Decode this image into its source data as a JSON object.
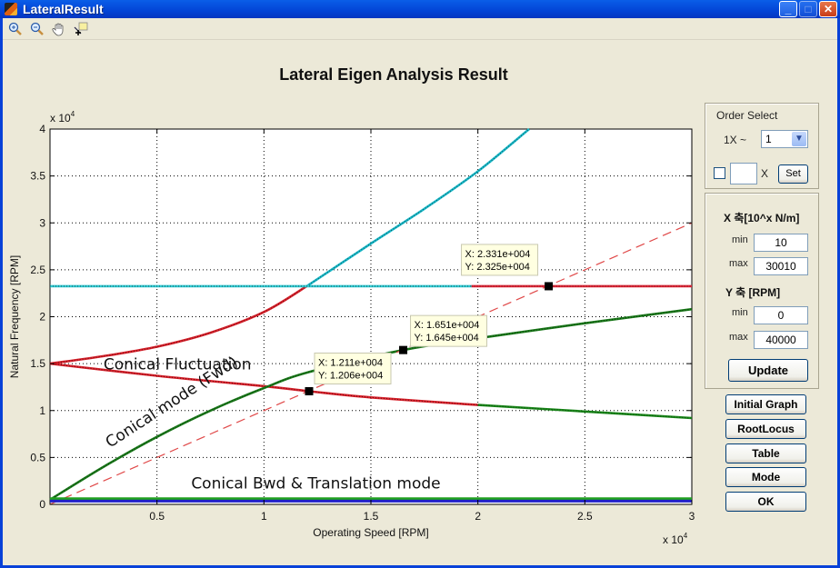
{
  "window": {
    "title": "LateralResult",
    "buttons": [
      "minimize",
      "maximize",
      "close"
    ]
  },
  "toolbar": {
    "tools": [
      "zoom-in-icon",
      "zoom-out-icon",
      "pan-hand-icon",
      "data-cursor-icon"
    ]
  },
  "plot_title": "Lateral Eigen Analysis Result",
  "order_select": {
    "title": "Order Select",
    "prefix": "1X ~",
    "selected": "1",
    "custom_checked": false,
    "custom_value": "",
    "x_suffix": "X",
    "set_label": "Set"
  },
  "axis_panel": {
    "x_title": "X 축[10^x N/m]",
    "x_min_label": "min",
    "x_min": "10",
    "x_max_label": "max",
    "x_max": "30010",
    "y_title": "Y 축 [RPM]",
    "y_min_label": "min",
    "y_min": "0",
    "y_max_label": "max",
    "y_max": "40000",
    "update_label": "Update"
  },
  "actions": [
    "Initial Graph",
    "RootLocus",
    "Table",
    "Mode",
    "OK"
  ],
  "chart_data": {
    "type": "line",
    "title": "Lateral Eigen Analysis Result",
    "xlabel": "Operating Speed [RPM]",
    "ylabel": "Natural Frequency [RPM]",
    "x_multiplier": "x 10^4",
    "y_multiplier": "x 10^4",
    "xlim": [
      0,
      3
    ],
    "ylim": [
      0,
      4
    ],
    "xticks": [
      0.5,
      1,
      1.5,
      2,
      2.5,
      3
    ],
    "xtick_labels": [
      "0.5",
      "1",
      "1.5",
      "2",
      "2.5",
      "3"
    ],
    "yticks": [
      0,
      0.5,
      1,
      1.5,
      2,
      2.5,
      3,
      3.5,
      4
    ],
    "ytick_labels": [
      "0",
      "0.5",
      "1",
      "1.5",
      "2",
      "2.5",
      "3",
      "3.5",
      "4"
    ],
    "grid": true,
    "series": [
      {
        "name": "fluctuation-upper-red",
        "color": "#d8202a",
        "style": "dotted-thick",
        "x": [
          0,
          0.25,
          0.5,
          0.75,
          1.0,
          1.2
        ],
        "y": [
          1.5,
          1.58,
          1.68,
          1.83,
          2.05,
          2.325
        ]
      },
      {
        "name": "fluctuation-upper-cyan",
        "color": "#18b8c8",
        "style": "dotted-thick",
        "x": [
          1.2,
          1.5,
          1.75,
          2.0,
          2.24
        ],
        "y": [
          2.325,
          2.78,
          3.15,
          3.55,
          4.0
        ]
      },
      {
        "name": "horizontal-cyan",
        "color": "#30c8d0",
        "style": "dotted-thick",
        "x": [
          0,
          1.97
        ],
        "y": [
          2.325,
          2.325
        ]
      },
      {
        "name": "horizontal-red",
        "color": "#e02838",
        "style": "dotted-thick",
        "x": [
          1.97,
          3.0
        ],
        "y": [
          2.325,
          2.325
        ]
      },
      {
        "name": "fluctuation-lower-red",
        "color": "#d8202a",
        "style": "dotted-thick",
        "x": [
          0,
          0.5,
          1.0,
          1.21,
          1.5,
          2.0
        ],
        "y": [
          1.5,
          1.37,
          1.26,
          1.206,
          1.14,
          1.06
        ]
      },
      {
        "name": "fluctuation-lower-green",
        "color": "#1a8a1a",
        "style": "dotted-thick",
        "x": [
          2.0,
          2.5,
          3.0
        ],
        "y": [
          1.06,
          0.99,
          0.92
        ]
      },
      {
        "name": "conical-fwd-green",
        "color": "#1a7a1a",
        "style": "dotted-thick",
        "x": [
          0,
          0.25,
          0.5,
          0.75,
          1.0,
          1.21,
          1.651,
          2.0,
          2.5,
          3.0
        ],
        "y": [
          0.05,
          0.4,
          0.72,
          1.0,
          1.24,
          1.41,
          1.645,
          1.77,
          1.93,
          2.08
        ]
      },
      {
        "name": "1x-line",
        "color": "#e04848",
        "style": "dashed",
        "x": [
          0,
          3
        ],
        "y": [
          0,
          3
        ]
      },
      {
        "name": "bwd-green",
        "color": "#20a020",
        "style": "solid-thick",
        "x": [
          0,
          3
        ],
        "y": [
          0.06,
          0.06
        ]
      },
      {
        "name": "translation-blue",
        "color": "#2020c8",
        "style": "solid-thick",
        "x": [
          0,
          3
        ],
        "y": [
          0.035,
          0.035
        ]
      }
    ],
    "datatips": [
      {
        "x": 1.211,
        "y": 1.206,
        "label_x": "X: 1.211e+004",
        "label_y": "Y: 1.206e+004"
      },
      {
        "x": 1.651,
        "y": 1.645,
        "label_x": "X: 1.651e+004",
        "label_y": "Y: 1.645e+004"
      },
      {
        "x": 2.331,
        "y": 2.325,
        "label_x": "X: 2.331e+004",
        "label_y": "Y: 2.325e+004"
      }
    ],
    "annotations": [
      {
        "text": "Conical Fluctuation",
        "x": 0.25,
        "y": 1.44,
        "angle": 0
      },
      {
        "text": "Conical mode (Fwd)",
        "x": 0.28,
        "y": 0.6,
        "angle": -33
      },
      {
        "text": "Conical Bwd & Translation mode",
        "x": 0.66,
        "y": 0.17,
        "angle": 0
      }
    ]
  }
}
